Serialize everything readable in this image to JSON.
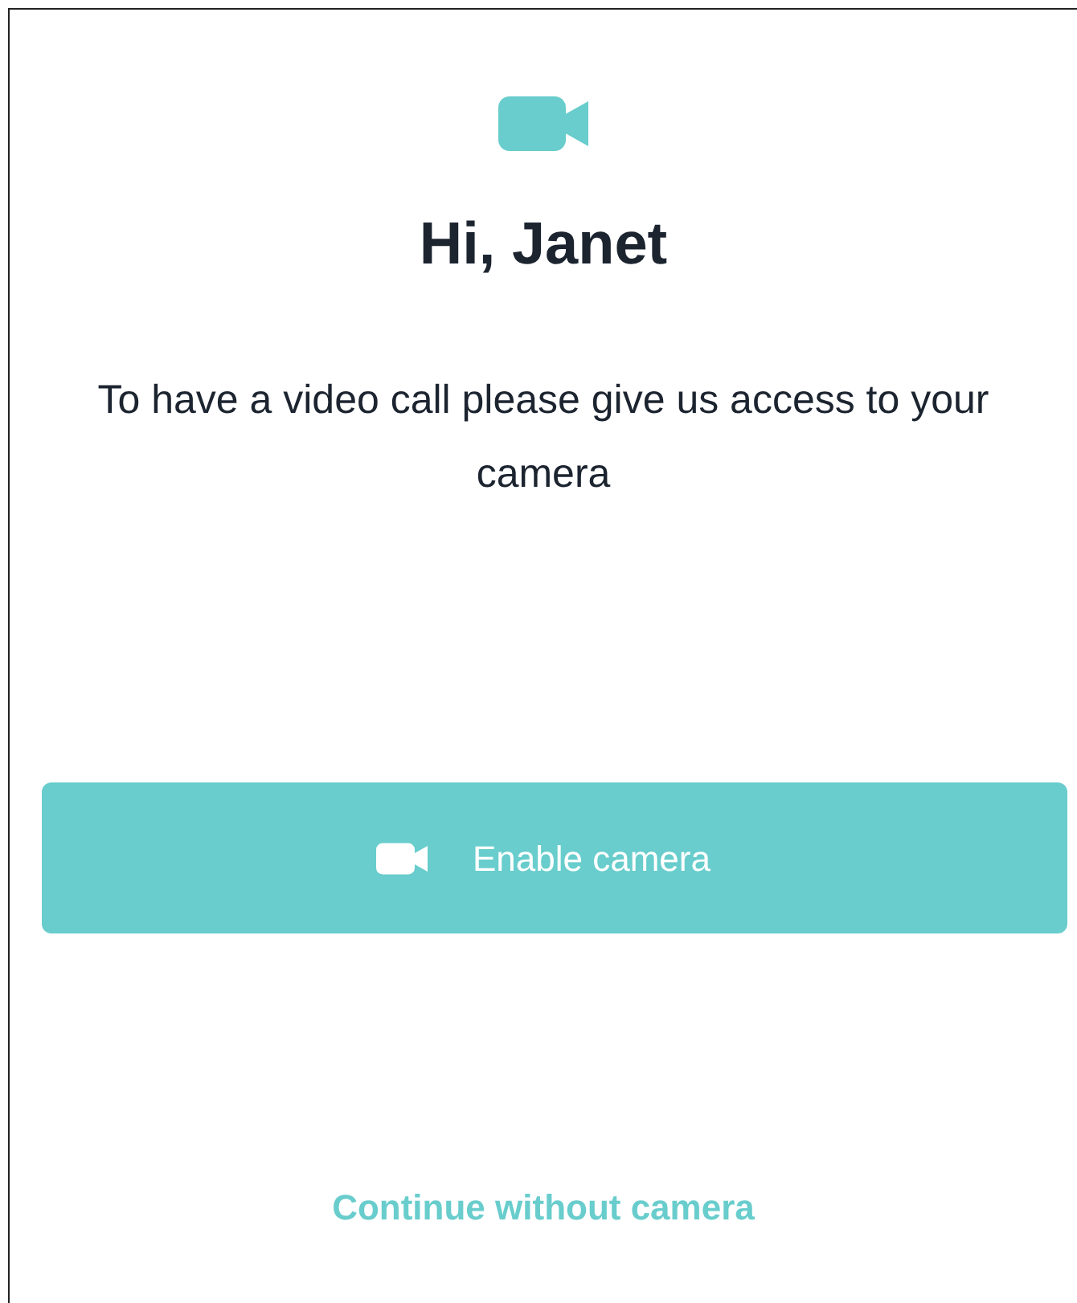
{
  "greeting": "Hi, Janet",
  "message": "To have a video call please give us access to your camera",
  "primary_button": {
    "label": "Enable camera"
  },
  "secondary_link": {
    "label": "Continue without camera"
  }
}
